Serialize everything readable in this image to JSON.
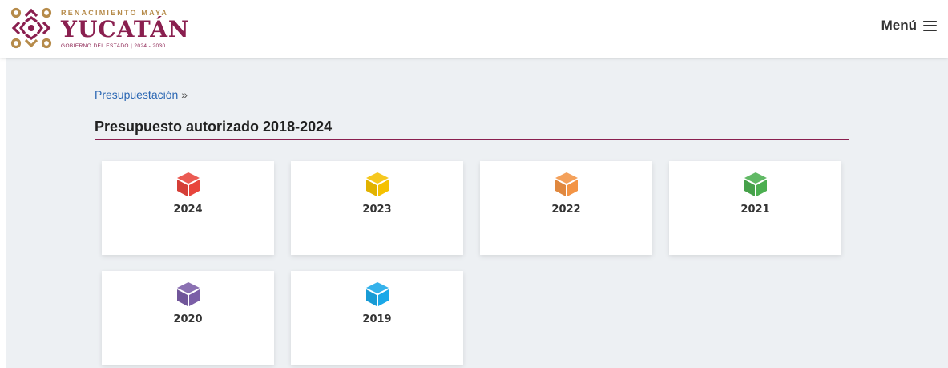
{
  "header": {
    "logo": {
      "tagline": "RENACIMIENTO MAYA",
      "name": "YUCATÁN",
      "subtitle": "GOBIERNO DEL ESTADO | 2024 - 2030"
    },
    "menu_label": "Menú",
    "menu_icon": "hamburger-icon"
  },
  "breadcrumb": {
    "link": "Presupuestación",
    "separator": "»"
  },
  "page_title": "Presupuesto autorizado 2018-2024",
  "colors": {
    "brand": "#8a1f4f",
    "brand_gold": "#b68b4a",
    "link": "#2b67b3",
    "background": "#edf0f3"
  },
  "cards": [
    {
      "label": "2024",
      "icon": "cube-icon",
      "color": "#e8453c"
    },
    {
      "label": "2023",
      "icon": "cube-icon",
      "color": "#f5c100"
    },
    {
      "label": "2022",
      "icon": "cube-icon",
      "color": "#f39445"
    },
    {
      "label": "2021",
      "icon": "cube-icon",
      "color": "#4caf50"
    },
    {
      "label": "2020",
      "icon": "cube-icon",
      "color": "#7b5ea7"
    },
    {
      "label": "2019",
      "icon": "cube-icon",
      "color": "#1aa8e8"
    }
  ]
}
